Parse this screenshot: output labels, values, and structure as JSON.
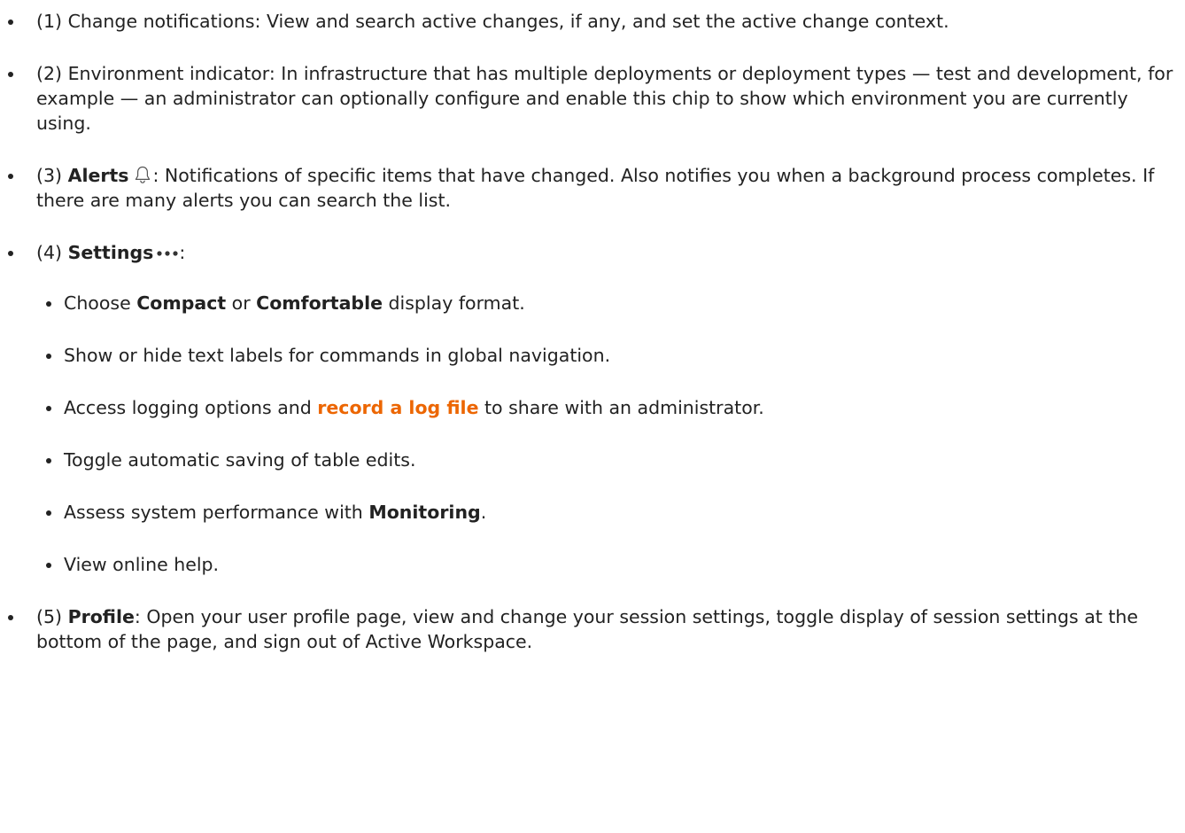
{
  "items": [
    {
      "num": "(1)",
      "text": " Change notifications: View and search active changes, if any, and set the active change context."
    },
    {
      "num": "(2)",
      "text": " Environment indicator: In infrastructure that has multiple deployments or deployment types — test and development, for example — an administrator can optionally configure and enable this chip to show which environment you are currently using."
    },
    {
      "num": "(3)",
      "bold": "Alerts",
      "icon": "bell-icon",
      "text": ": Notifications of specific items that have changed. Also notifies you when a background process completes. If there are many alerts you can search the list."
    },
    {
      "num": "(4)",
      "bold": "Settings",
      "icon": "more-dots-icon",
      "text": ":",
      "subitems": [
        {
          "pre": "Choose ",
          "bold1": "Compact",
          "mid": " or ",
          "bold2": "Comfortable",
          "post": " display format."
        },
        {
          "text": "Show or hide text labels for commands in global navigation."
        },
        {
          "pre": "Access logging options and ",
          "link": "record a log file",
          "post": " to share with an administrator."
        },
        {
          "text": "Toggle automatic saving of table edits."
        },
        {
          "pre": "Assess system performance with ",
          "bold": "Monitoring",
          "post": "."
        },
        {
          "text": "View online help."
        }
      ]
    },
    {
      "num": "(5)",
      "bold": "Profile",
      "text": ": Open your user profile page, view and change your session settings, toggle display of session settings at the bottom of the page, and sign out of Active Workspace."
    }
  ],
  "colors": {
    "text": "#222222",
    "link": "#ec6602"
  }
}
